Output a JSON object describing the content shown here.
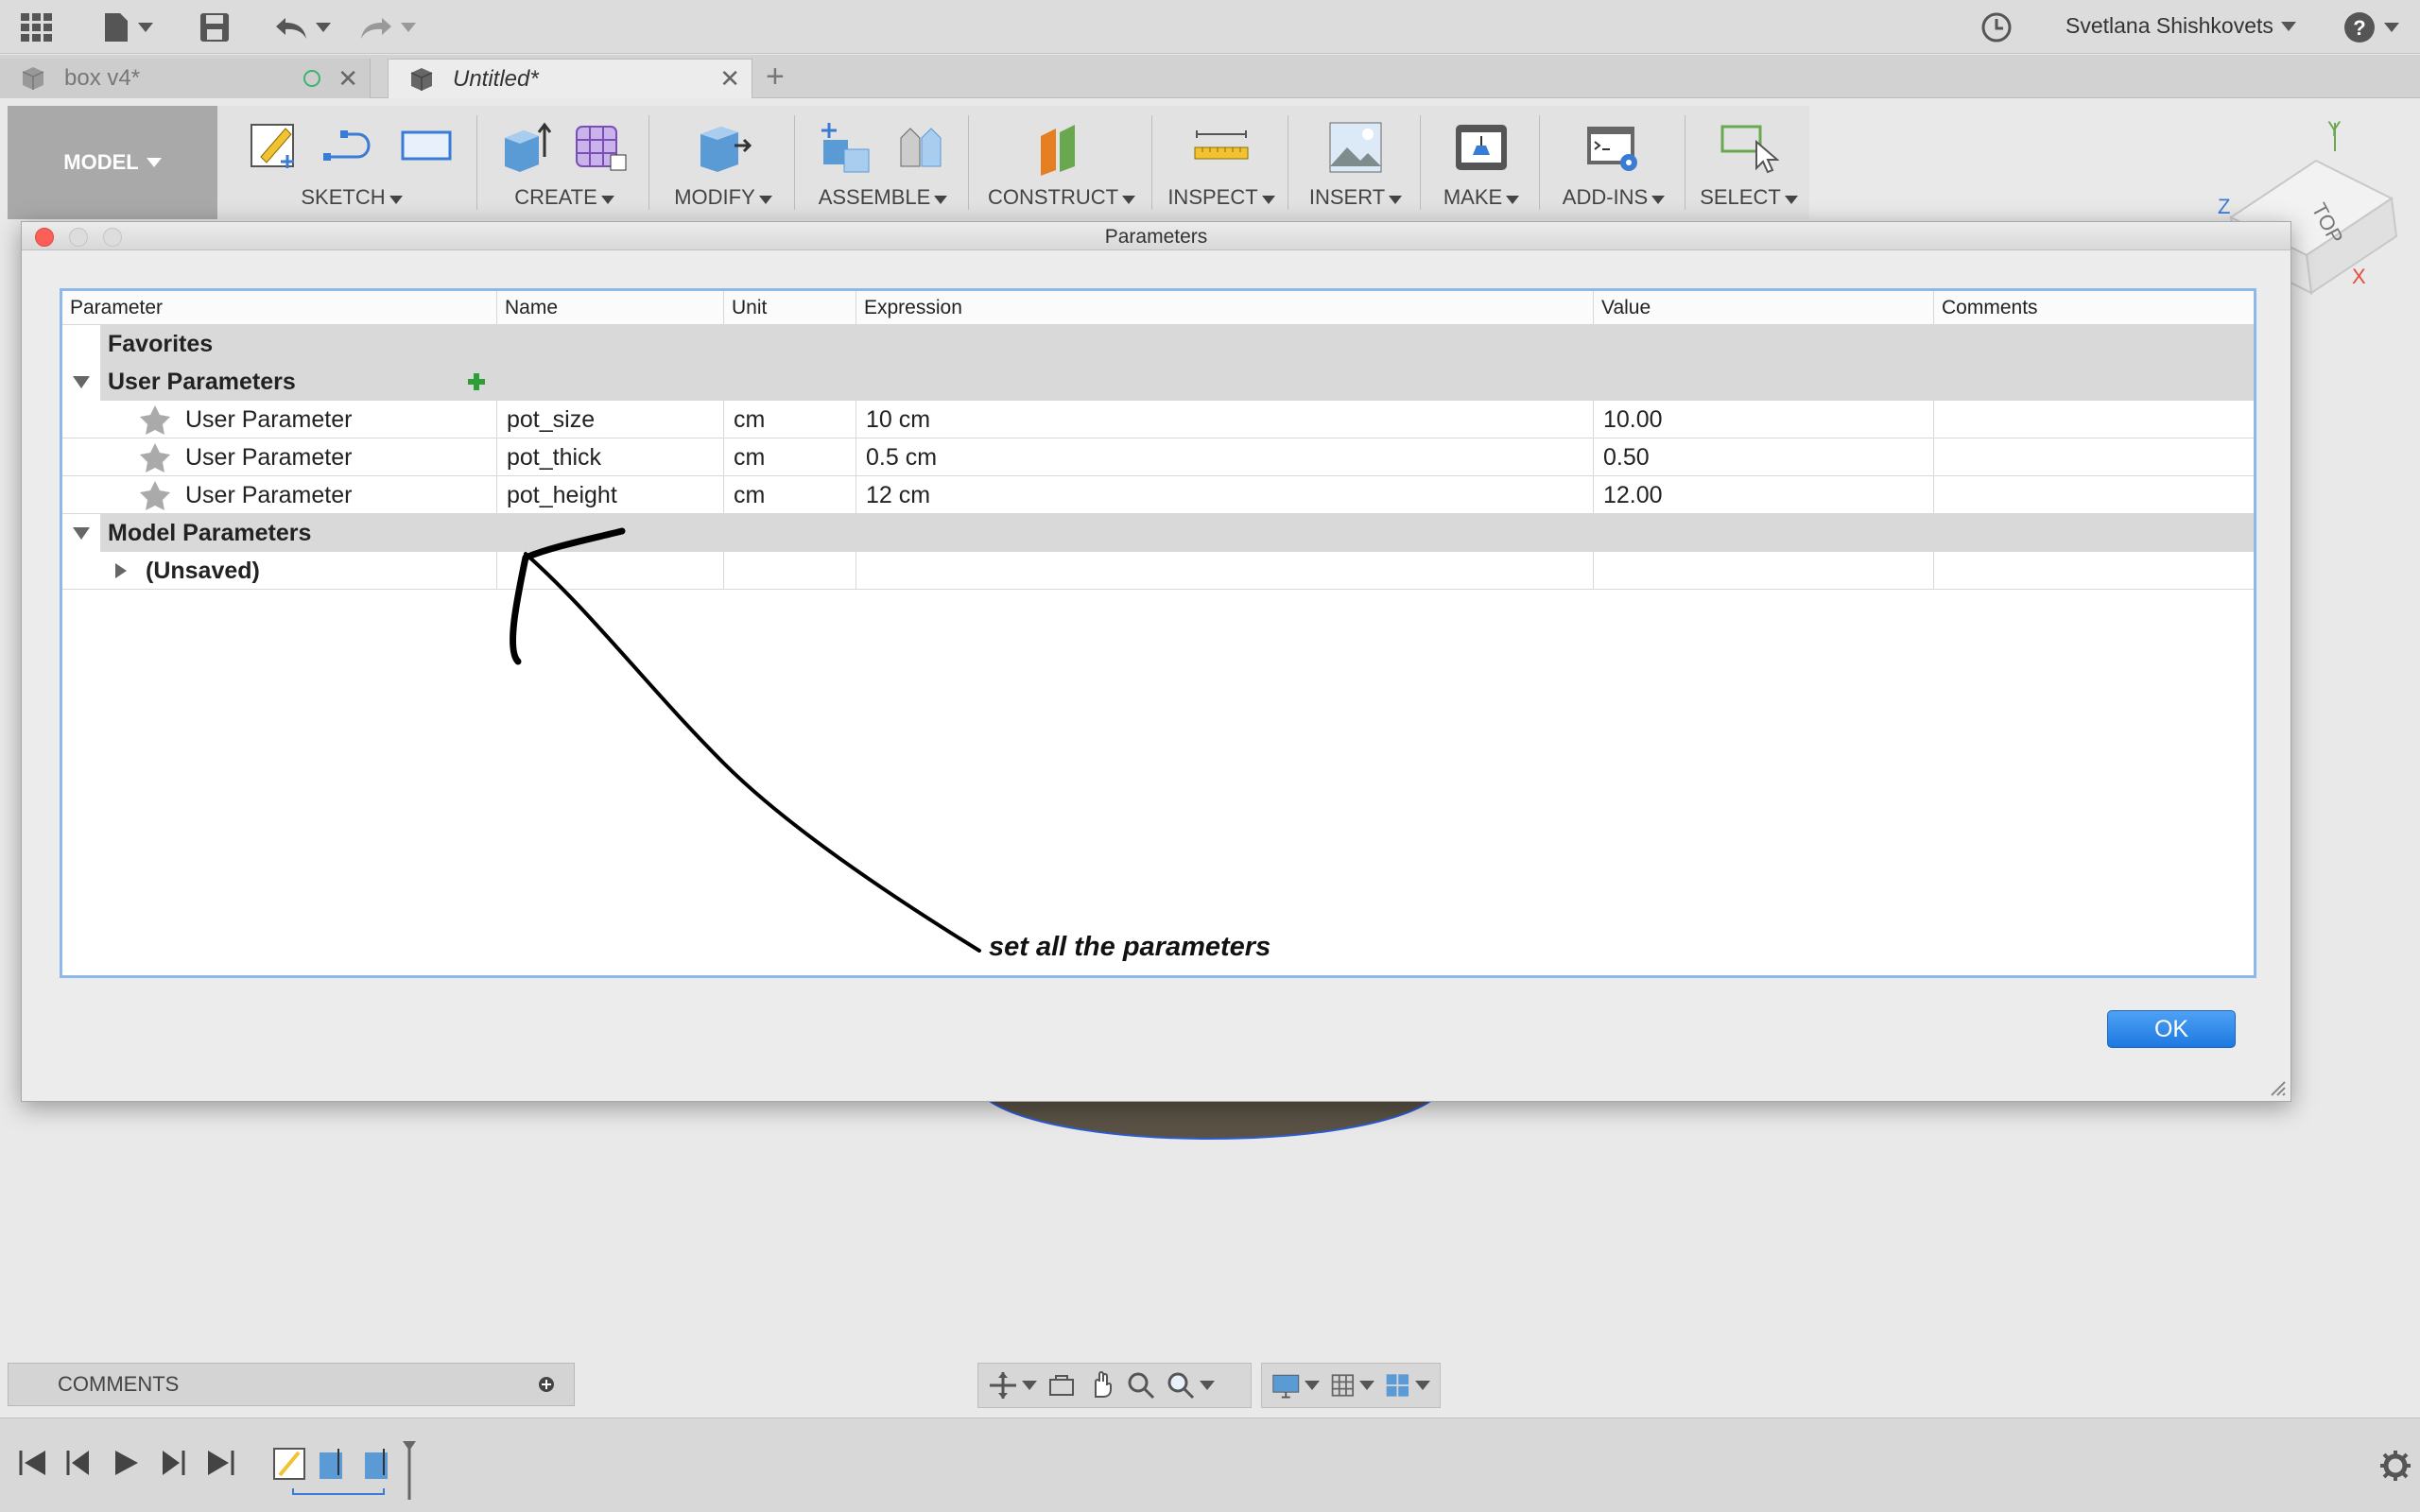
{
  "user": {
    "name": "Svetlana Shishkovets"
  },
  "tabs": [
    {
      "label": "box v4*"
    },
    {
      "label": "Untitled*"
    }
  ],
  "toolbar": {
    "workspace": "MODEL",
    "groups": [
      "SKETCH",
      "CREATE",
      "MODIFY",
      "ASSEMBLE",
      "CONSTRUCT",
      "INSPECT",
      "INSERT",
      "MAKE",
      "ADD-INS",
      "SELECT"
    ]
  },
  "viewcube": {
    "face": "TOP",
    "axes": {
      "x": "X",
      "y": "Y",
      "z": "Z"
    }
  },
  "dialog": {
    "title": "Parameters",
    "columns": [
      "Parameter",
      "Name",
      "Unit",
      "Expression",
      "Value",
      "Comments"
    ],
    "groups": {
      "favorites": "Favorites",
      "user": "User Parameters",
      "model": "Model Parameters",
      "unsaved": "(Unsaved)"
    },
    "rows": [
      {
        "parameter": "User Parameter",
        "name": "pot_size",
        "unit": "cm",
        "expression": "10 cm",
        "value": "10.00",
        "comments": ""
      },
      {
        "parameter": "User Parameter",
        "name": "pot_thick",
        "unit": "cm",
        "expression": "0.5 cm",
        "value": "0.50",
        "comments": ""
      },
      {
        "parameter": "User Parameter",
        "name": "pot_height",
        "unit": "cm",
        "expression": "12 cm",
        "value": "12.00",
        "comments": ""
      }
    ],
    "annotation": "set all the parameters",
    "ok": "OK"
  },
  "bottom": {
    "comments": "COMMENTS"
  }
}
